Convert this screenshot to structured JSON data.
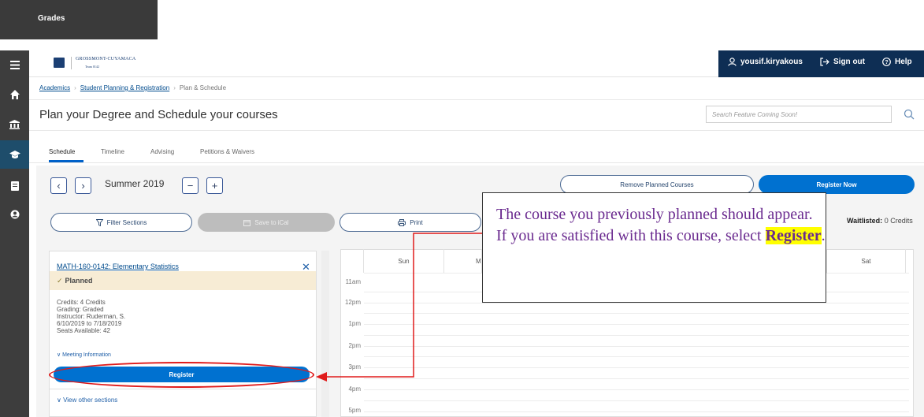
{
  "top_tab": {
    "label": "Grades"
  },
  "header": {
    "logo_text": "GROSSMONT-CUYAMACA",
    "logo_sub": "Team 0142",
    "user": "yousif.kiryakous",
    "sign_out": "Sign out",
    "help": "Help"
  },
  "breadcrumb": [
    "Academics",
    "Student Planning & Registration",
    "Plan & Schedule"
  ],
  "page": {
    "title": "Plan your Degree and Schedule your courses",
    "search_placeholder": "Search Feature Coming Soon!"
  },
  "tabs": [
    "Schedule",
    "Timeline",
    "Advising",
    "Petitions & Waivers"
  ],
  "term": {
    "label": "Summer 2019",
    "prev": "‹",
    "next": "›",
    "minus": "−",
    "plus": "+"
  },
  "actions": {
    "remove_planned": "Remove Planned Courses",
    "register_now": "Register Now",
    "filter_sections": "Filter Sections",
    "save_ical": "Save to iCal",
    "print": "Print"
  },
  "waitlisted": {
    "label": "Waitlisted:",
    "value": "0 Credits"
  },
  "course": {
    "title": "MATH-160-0142: Elementary Statistics",
    "status": "Planned",
    "details": [
      "Credits: 4 Credits",
      "Grading: Graded",
      "Instructor: Ruderman, S.",
      "6/10/2019 to 7/18/2019",
      "Seats Available:  42"
    ],
    "meeting_info": "Meeting Information",
    "register": "Register",
    "view_other": "View other sections"
  },
  "calendar": {
    "days": [
      "Sun",
      "M",
      "Sat"
    ],
    "times": [
      "11am",
      "12pm",
      "1pm",
      "2pm",
      "3pm",
      "4pm",
      "5pm"
    ]
  },
  "callout": {
    "text": "The course you previously planned should appear. If you are satisfied with this course, select ",
    "highlight": "Register",
    "end": "."
  },
  "colors": {
    "primary": "#0071d0",
    "nav_dark": "#0e2e54",
    "annotation_red": "#e01b1b",
    "callout_text": "#6a2a8f",
    "highlight": "#ffff00"
  }
}
